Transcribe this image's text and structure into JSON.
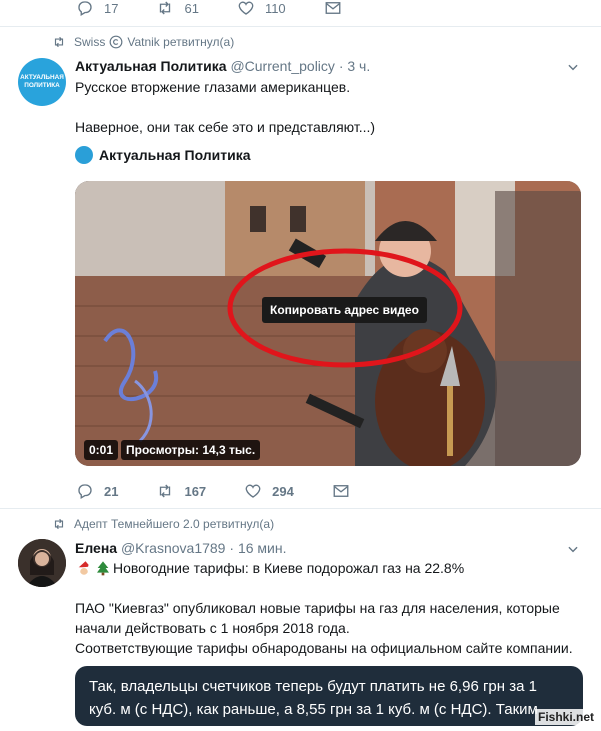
{
  "top_actions": {
    "reply_count": "17",
    "retweet_count": "61",
    "like_count": "110"
  },
  "tweet1": {
    "retweeter_prefix": "Swiss",
    "retweeter_suffix": "Vatnik ретвитнул(а)",
    "avatar_text": "АКТУАЛЬНАЯ ПОЛИТИКА",
    "author_name": "Актуальная Политика",
    "author_handle": "@Current_policy",
    "separator": "·",
    "time": "3 ч.",
    "text_line1": "Русское вторжение глазами американцев.",
    "text_line2": "Наверное, они так себе это и представляют...)",
    "media_author": "Актуальная Политика",
    "video": {
      "copy_button": "Копировать адрес видео",
      "time": "0:01",
      "views": "Просмотры: 14,3 тыс."
    },
    "reply_count": "21",
    "retweet_count": "167",
    "like_count": "294"
  },
  "tweet2": {
    "retweeter": "Адепт Темнейшего 2.0 ретвитнул(а)",
    "author_name": "Елена",
    "author_handle": "@Krasnova1789",
    "separator": "·",
    "time": "16 мин.",
    "headline": "Новогодние тарифы: в Киеве подорожал газ на 22.8%",
    "body_line1": "ПАО \"Киевгаз\" опубликовал новые тарифы на газ для населения, которые",
    "body_line2": "начали действовать с 1 ноября 2018 года.",
    "body_line3": "Соответствующие тарифы обнародованы на официальном сайте компании.",
    "quote_line1": "Так, владельцы счетчиков теперь будут платить не 6,96 грн за 1",
    "quote_line2": "куб. м (с НДС), как раньше, а 8,55 грн за 1 куб. м (с НДС). Таким"
  },
  "watermark": "Fishki.net",
  "icons": [
    "reply-icon",
    "retweet-icon",
    "like-icon",
    "dm-icon",
    "chevron-down-icon",
    "copyright-icon",
    "santa-emoji",
    "tree-emoji"
  ],
  "colors": {
    "meta": "#657786",
    "text": "#14171a",
    "highlight_ellipse": "#e0151b",
    "quote_bg": "#1f2d3b"
  }
}
